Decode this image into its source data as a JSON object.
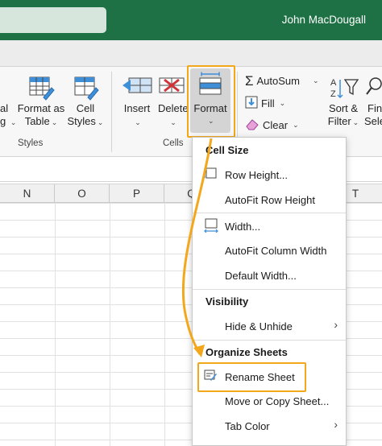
{
  "titlebar": {
    "user_name": "John MacDougall",
    "accent": "#1e7145"
  },
  "ribbon": {
    "styles_group": {
      "partial_left_top": "al",
      "partial_left_bottom": "g",
      "format_as_table_line1": "Format as",
      "format_as_table_line2": "Table",
      "cell_styles_line1": "Cell",
      "cell_styles_line2": "Styles",
      "label": "Styles"
    },
    "cells_group": {
      "insert": "Insert",
      "delete": "Delete",
      "format": "Format",
      "label": "Cells"
    },
    "editing_group": {
      "autosum": "AutoSum",
      "fill": "Fill",
      "clear": "Clear",
      "sort_filter_line1": "Sort &",
      "sort_filter_line2": "Filter",
      "find_partial_line1": "Fin",
      "find_partial_line2": "Sele"
    }
  },
  "sheet": {
    "columns": [
      "N",
      "O",
      "P",
      "Q",
      "T"
    ]
  },
  "format_menu": {
    "cell_size_header": "Cell Size",
    "row_height": "Row Height...",
    "autofit_row_height": "AutoFit Row Height",
    "width": "Width...",
    "autofit_column_width": "AutoFit Column Width",
    "default_width": "Default Width...",
    "visibility_header": "Visibility",
    "hide_unhide": "Hide & Unhide",
    "organize_sheets_header": "Organize Sheets",
    "rename_sheet": "Rename Sheet",
    "move_copy_sheet": "Move or Copy Sheet...",
    "tab_color": "Tab Color"
  },
  "highlight_color": "#f3a81c"
}
